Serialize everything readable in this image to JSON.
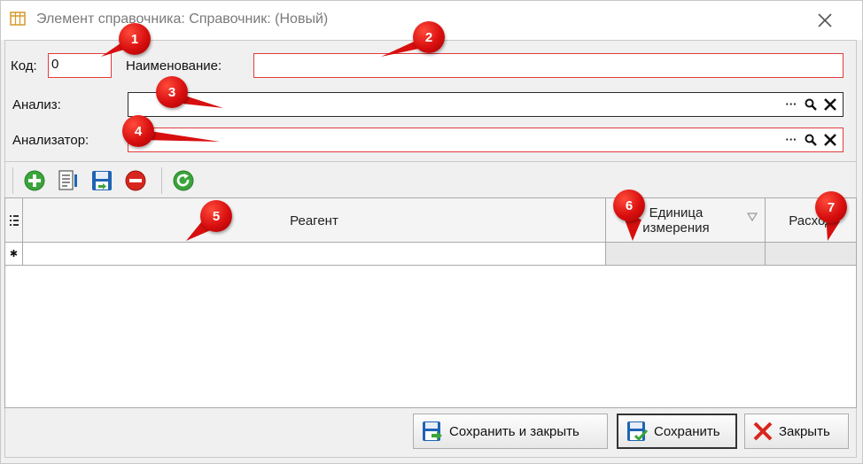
{
  "window": {
    "title": "Элемент справочника: Справочник: (Новый)"
  },
  "form": {
    "code_label": "Код:",
    "code_value": "0",
    "name_label": "Наименование:",
    "name_value": "",
    "analysis_label": "Анализ:",
    "analysis_value": "",
    "analyzer_label": "Анализатор:",
    "analyzer_value": "",
    "select_button_text": "···"
  },
  "toolbar": {
    "items": [
      "add-icon",
      "edit-icon",
      "save-icon",
      "delete-icon",
      "refresh-icon"
    ]
  },
  "grid": {
    "columns": [
      "Реагент",
      "Единица измерения",
      "Расход"
    ],
    "new_row_marker": "✱"
  },
  "footer": {
    "save_close_label": "Сохранить и закрыть",
    "save_label": "Сохранить",
    "close_label": "Закрыть"
  },
  "callouts": [
    "1",
    "2",
    "3",
    "4",
    "5",
    "6",
    "7"
  ],
  "colors": {
    "error_border": "#e23b3b",
    "marker_red": "#d80f0f",
    "add_green": "#3aa53a",
    "delete_red": "#d7261e",
    "save_blue": "#1e64b4"
  }
}
